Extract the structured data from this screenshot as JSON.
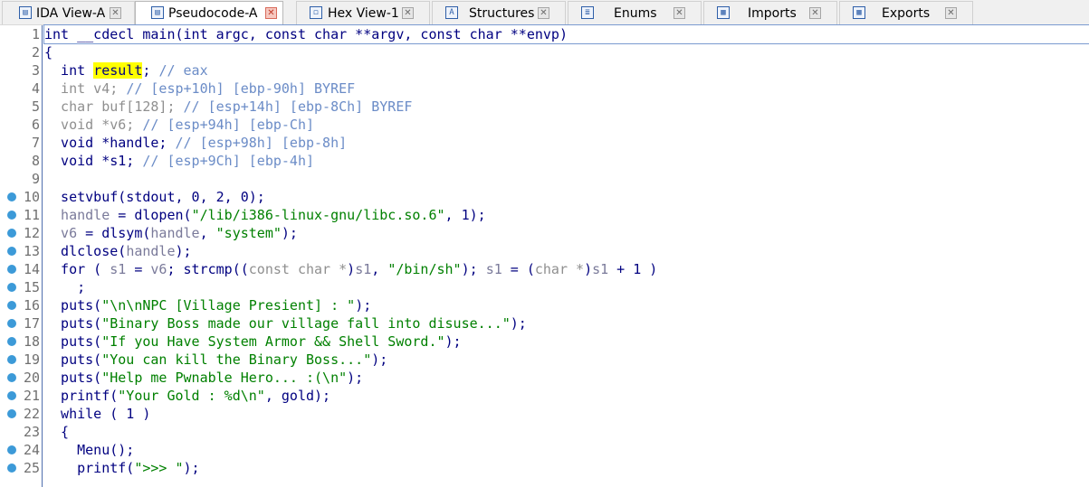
{
  "tabs": [
    {
      "label": "IDA View-A",
      "icon": "graph-view-icon",
      "active": false
    },
    {
      "label": "Pseudocode-A",
      "icon": "pseudocode-icon",
      "active": true
    },
    {
      "label": "Hex View-1",
      "icon": "hex-view-icon",
      "active": false
    },
    {
      "label": "Structures",
      "icon": "structures-icon",
      "active": false
    },
    {
      "label": "Enums",
      "icon": "enums-icon",
      "active": false
    },
    {
      "label": "Imports",
      "icon": "imports-icon",
      "active": false
    },
    {
      "label": "Exports",
      "icon": "exports-icon",
      "active": false
    }
  ],
  "lines": [
    {
      "n": "1",
      "bp": false,
      "tokens": [
        [
          "kw",
          "int "
        ],
        [
          "punc",
          "__cdecl main(int argc, const char **argv, const char **envp)"
        ]
      ]
    },
    {
      "n": "2",
      "bp": false,
      "tokens": [
        [
          "punc",
          "{"
        ]
      ]
    },
    {
      "n": "3",
      "bp": false,
      "tokens": [
        [
          "kw",
          "  int "
        ],
        [
          "hl",
          "result"
        ],
        [
          "punc",
          "; "
        ],
        [
          "cmt",
          "// eax"
        ]
      ]
    },
    {
      "n": "4",
      "bp": false,
      "tokens": [
        [
          "gray",
          "  int v4; "
        ],
        [
          "cmt",
          "// [esp+10h] [ebp-90h] BYREF"
        ]
      ]
    },
    {
      "n": "5",
      "bp": false,
      "tokens": [
        [
          "gray",
          "  char buf[128]; "
        ],
        [
          "cmt",
          "// [esp+14h] [ebp-8Ch] BYREF"
        ]
      ]
    },
    {
      "n": "6",
      "bp": false,
      "tokens": [
        [
          "gray",
          "  void *v6; "
        ],
        [
          "cmt",
          "// [esp+94h] [ebp-Ch]"
        ]
      ]
    },
    {
      "n": "7",
      "bp": false,
      "tokens": [
        [
          "kw",
          "  void *handle; "
        ],
        [
          "cmt",
          "// [esp+98h] [ebp-8h]"
        ]
      ]
    },
    {
      "n": "8",
      "bp": false,
      "tokens": [
        [
          "kw",
          "  void *s1; "
        ],
        [
          "cmt",
          "// [esp+9Ch] [ebp-4h]"
        ]
      ]
    },
    {
      "n": "9",
      "bp": false,
      "tokens": [
        [
          "punc",
          ""
        ]
      ]
    },
    {
      "n": "10",
      "bp": true,
      "tokens": [
        [
          "punc",
          "  setvbuf(stdout, 0, 2, 0);"
        ]
      ]
    },
    {
      "n": "11",
      "bp": true,
      "tokens": [
        [
          "var",
          "  handle"
        ],
        [
          "punc",
          " = dlopen("
        ],
        [
          "str",
          "\"/lib/i386-linux-gnu/libc.so.6\""
        ],
        [
          "punc",
          ", 1);"
        ]
      ]
    },
    {
      "n": "12",
      "bp": true,
      "tokens": [
        [
          "var",
          "  v6"
        ],
        [
          "punc",
          " = dlsym("
        ],
        [
          "var",
          "handle"
        ],
        [
          "punc",
          ", "
        ],
        [
          "str",
          "\"system\""
        ],
        [
          "punc",
          ");"
        ]
      ]
    },
    {
      "n": "13",
      "bp": true,
      "tokens": [
        [
          "punc",
          "  dlclose("
        ],
        [
          "var",
          "handle"
        ],
        [
          "punc",
          ");"
        ]
      ]
    },
    {
      "n": "14",
      "bp": true,
      "tokens": [
        [
          "punc",
          "  for ( "
        ],
        [
          "var",
          "s1"
        ],
        [
          "punc",
          " = "
        ],
        [
          "var",
          "v6"
        ],
        [
          "punc",
          "; strcmp(("
        ],
        [
          "gray",
          "const char *"
        ],
        [
          "punc",
          ")"
        ],
        [
          "var",
          "s1"
        ],
        [
          "punc",
          ", "
        ],
        [
          "str",
          "\"/bin/sh\""
        ],
        [
          "punc",
          "); "
        ],
        [
          "var",
          "s1"
        ],
        [
          "punc",
          " = ("
        ],
        [
          "gray",
          "char *"
        ],
        [
          "punc",
          ")"
        ],
        [
          "var",
          "s1"
        ],
        [
          "punc",
          " + 1 )"
        ]
      ]
    },
    {
      "n": "15",
      "bp": true,
      "tokens": [
        [
          "punc",
          "    ;"
        ]
      ]
    },
    {
      "n": "16",
      "bp": true,
      "tokens": [
        [
          "punc",
          "  puts("
        ],
        [
          "str",
          "\"\\n\\nNPC [Village Presient] : \""
        ],
        [
          "punc",
          ");"
        ]
      ]
    },
    {
      "n": "17",
      "bp": true,
      "tokens": [
        [
          "punc",
          "  puts("
        ],
        [
          "str",
          "\"Binary Boss made our village fall into disuse...\""
        ],
        [
          "punc",
          ");"
        ]
      ]
    },
    {
      "n": "18",
      "bp": true,
      "tokens": [
        [
          "punc",
          "  puts("
        ],
        [
          "str",
          "\"If you Have System Armor && Shell Sword.\""
        ],
        [
          "punc",
          ");"
        ]
      ]
    },
    {
      "n": "19",
      "bp": true,
      "tokens": [
        [
          "punc",
          "  puts("
        ],
        [
          "str",
          "\"You can kill the Binary Boss...\""
        ],
        [
          "punc",
          ");"
        ]
      ]
    },
    {
      "n": "20",
      "bp": true,
      "tokens": [
        [
          "punc",
          "  puts("
        ],
        [
          "str",
          "\"Help me Pwnable Hero... :(\\n\""
        ],
        [
          "punc",
          ");"
        ]
      ]
    },
    {
      "n": "21",
      "bp": true,
      "tokens": [
        [
          "punc",
          "  printf("
        ],
        [
          "str",
          "\"Your Gold : %d\\n\""
        ],
        [
          "punc",
          ", gold);"
        ]
      ]
    },
    {
      "n": "22",
      "bp": true,
      "tokens": [
        [
          "punc",
          "  while ( 1 )"
        ]
      ]
    },
    {
      "n": "23",
      "bp": false,
      "tokens": [
        [
          "punc",
          "  {"
        ]
      ]
    },
    {
      "n": "24",
      "bp": true,
      "tokens": [
        [
          "punc",
          "    Menu();"
        ]
      ]
    },
    {
      "n": "25",
      "bp": true,
      "tokens": [
        [
          "punc",
          "    printf("
        ],
        [
          "str",
          "\">>> \""
        ],
        [
          "punc",
          ");"
        ]
      ]
    }
  ],
  "colors": {
    "keyword": "#000080",
    "string": "#008000",
    "comment": "#6b8cc7",
    "highlight": "#ffff00",
    "breakpoint": "#3c9ad8"
  }
}
